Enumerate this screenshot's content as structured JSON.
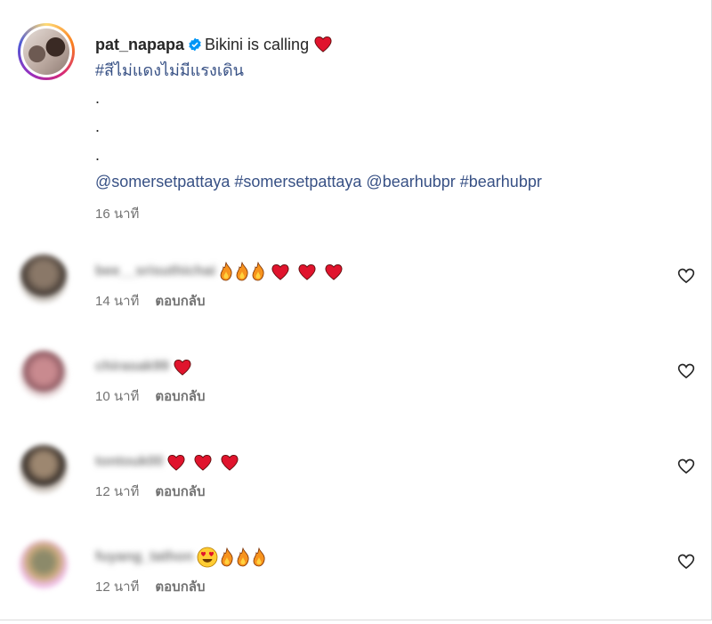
{
  "post": {
    "username": "pat_napapa",
    "caption_text": "Bikini is calling",
    "hashtag_line": "#สีไม่แดงไม่มีแรงเดิน",
    "dots": [
      ".",
      ".",
      "."
    ],
    "mentions_line": "@somersetpattaya #somersetpattaya @bearhubpr #bearhubpr",
    "time": "16 นาที"
  },
  "comments": [
    {
      "username": "bee__srisuthichai",
      "emoji_text": "🔥🔥🔥❤️❤️❤️",
      "time": "14 นาที",
      "reply_label": "ตอบกลับ"
    },
    {
      "username": "chirasak99",
      "emoji_text": "❤️",
      "time": "10 นาที",
      "reply_label": "ตอบกลับ"
    },
    {
      "username": "tontouk00",
      "emoji_text": "❤️❤️❤️",
      "time": "12 นาที",
      "reply_label": "ตอบกลับ"
    },
    {
      "username": "fuyang_tathon",
      "emoji_text": "😍🔥🔥🔥",
      "time": "12 นาที",
      "reply_label": "ตอบกลับ"
    }
  ],
  "icons": {
    "verified": "verified-badge-icon",
    "like": "heart-outline-icon"
  },
  "colors": {
    "link": "#385185",
    "muted": "#737373",
    "verified": "#0095f6",
    "heart": "#e0142d"
  }
}
